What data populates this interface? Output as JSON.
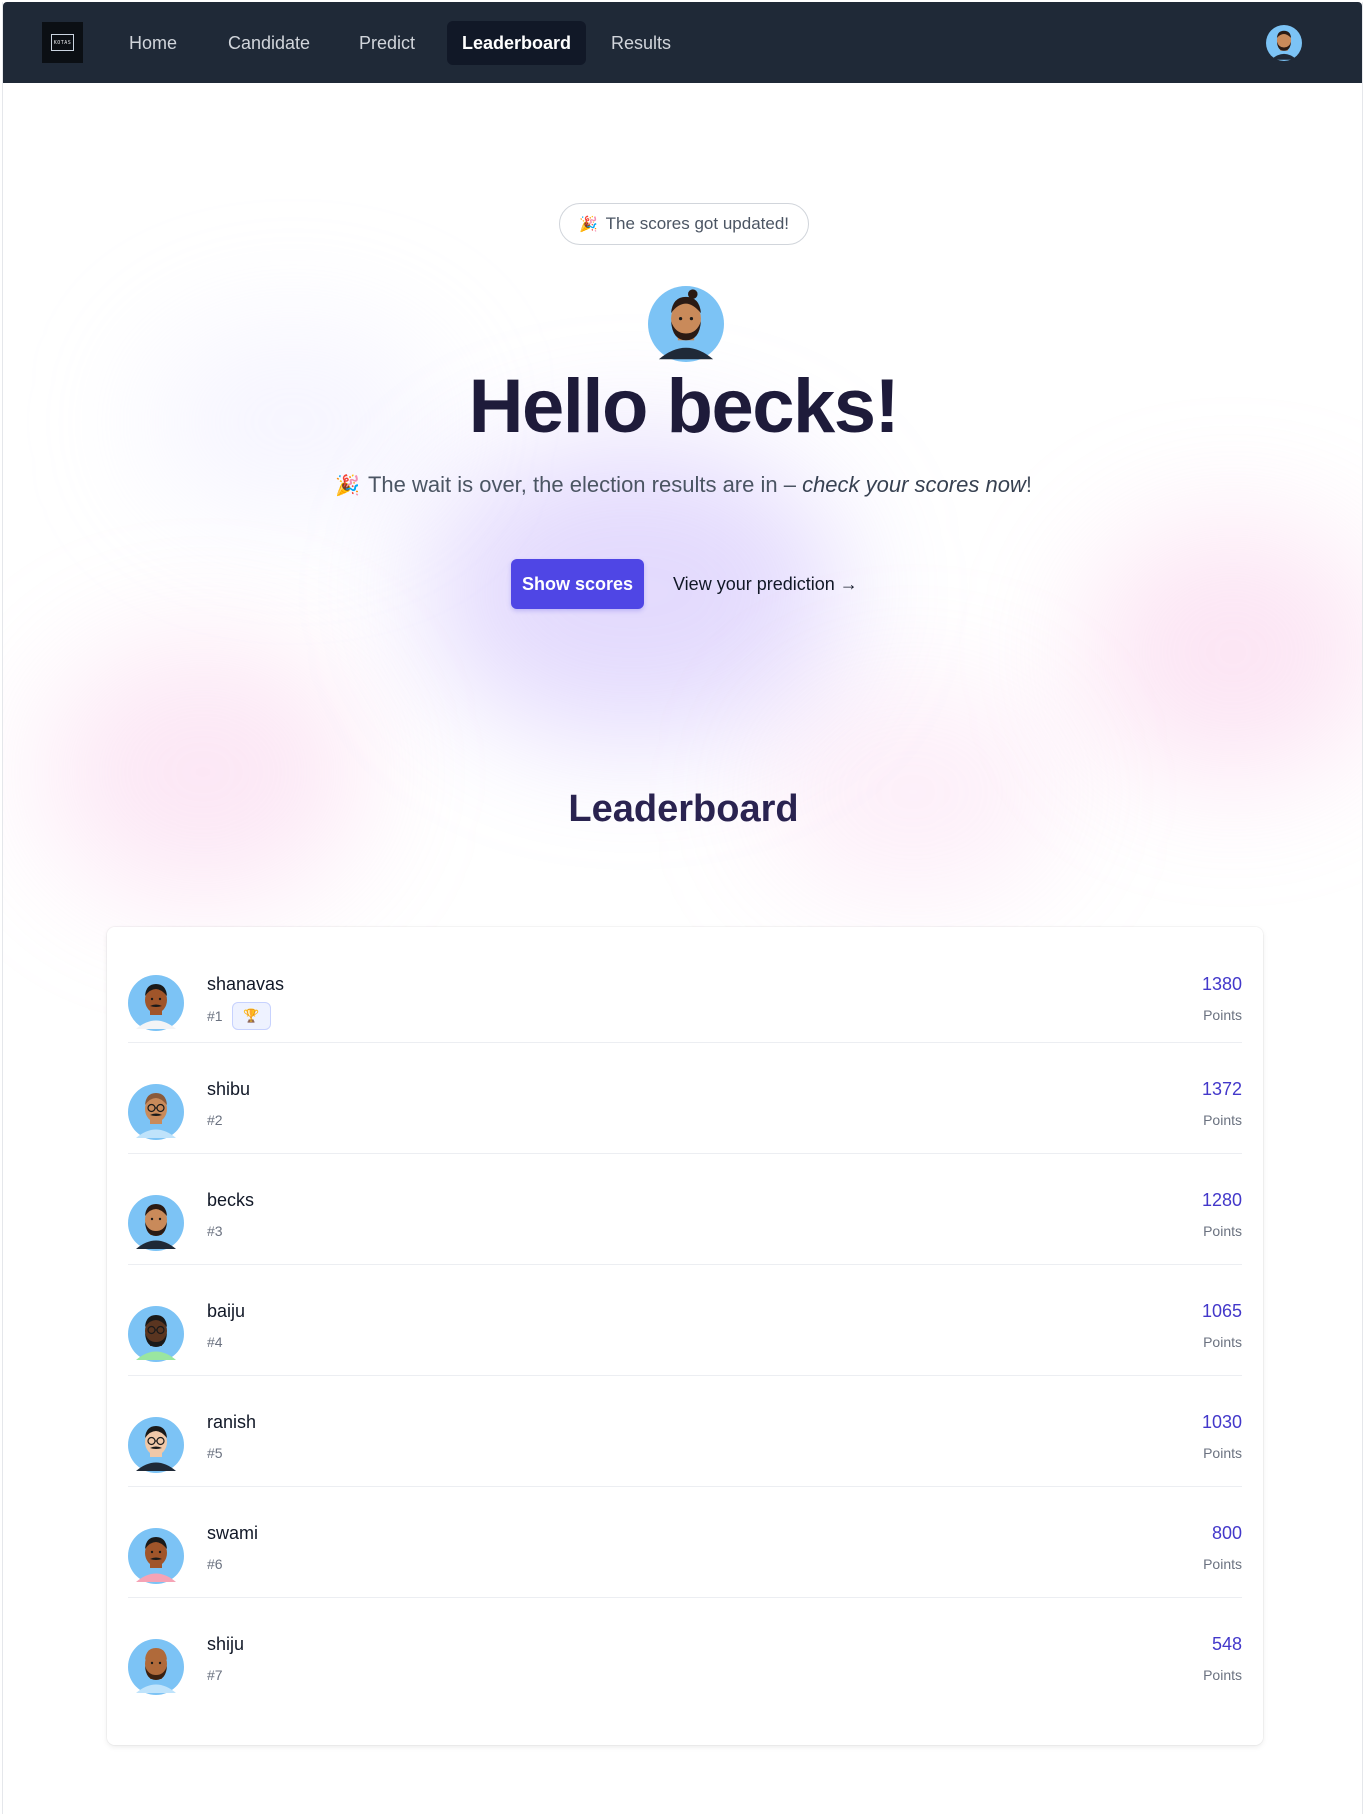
{
  "nav": {
    "logo_text": "KOTAS",
    "items": [
      {
        "label": "Home",
        "active": false
      },
      {
        "label": "Candidate",
        "active": false
      },
      {
        "label": "Predict",
        "active": false
      },
      {
        "label": "Leaderboard",
        "active": true
      },
      {
        "label": "Results",
        "active": false
      }
    ],
    "avatar_icon": "user-avatar-icon"
  },
  "hero": {
    "pill_emoji": "🎉",
    "pill_text": "The scores got updated!",
    "title": "Hello becks!",
    "sub_emoji": "🎉",
    "sub_text": "The wait is over, the election results are in – ",
    "sub_emphasis": "check your scores now",
    "sub_end": "!",
    "primary_button": "Show scores",
    "secondary_link": "View your prediction →"
  },
  "leaderboard": {
    "title": "Leaderboard",
    "points_label": "Points",
    "rows": [
      {
        "name": "shanavas",
        "rank": "#1",
        "points": "1380",
        "trophy": "🏆",
        "skin": "#a0552a",
        "hair": "#1a1a1a",
        "shirt": "#f3f4f6",
        "bg": "#7cc3f5",
        "beard": false,
        "glasses": false,
        "mustache": true
      },
      {
        "name": "shibu",
        "rank": "#2",
        "points": "1372",
        "skin": "#c98a5a",
        "hair": "#8a5a3a",
        "shirt": "#bfe3fb",
        "bg": "#7cc3f5",
        "beard": false,
        "glasses": true,
        "mustache": true
      },
      {
        "name": "becks",
        "rank": "#3",
        "points": "1280",
        "skin": "#c98a5a",
        "hair": "#2a1a14",
        "shirt": "#1f2937",
        "bg": "#7cc3f5",
        "beard": true,
        "glasses": false,
        "mustache": false
      },
      {
        "name": "baiju",
        "rank": "#4",
        "points": "1065",
        "skin": "#5a3520",
        "hair": "#1a1a1a",
        "shirt": "#9ae6a0",
        "bg": "#7cc3f5",
        "beard": true,
        "glasses": true,
        "mustache": false
      },
      {
        "name": "ranish",
        "rank": "#5",
        "points": "1030",
        "skin": "#f0c8a8",
        "hair": "#1a1a1a",
        "shirt": "#1f2937",
        "bg": "#7cc3f5",
        "beard": false,
        "glasses": true,
        "mustache": true
      },
      {
        "name": "swami",
        "rank": "#6",
        "points": "800",
        "skin": "#a0552a",
        "hair": "#1a1a1a",
        "shirt": "#f5a3b5",
        "bg": "#7cc3f5",
        "beard": false,
        "glasses": false,
        "mustache": true
      },
      {
        "name": "shiju",
        "rank": "#7",
        "points": "548",
        "skin": "#b06a3a",
        "hair": "#b06a3a",
        "shirt": "#bfe3fb",
        "bg": "#7cc3f5",
        "beard": true,
        "glasses": false,
        "mustache": false
      }
    ]
  },
  "colors": {
    "nav_bg": "#1f2937",
    "accent": "#4f46e5",
    "points": "#4338ca"
  }
}
